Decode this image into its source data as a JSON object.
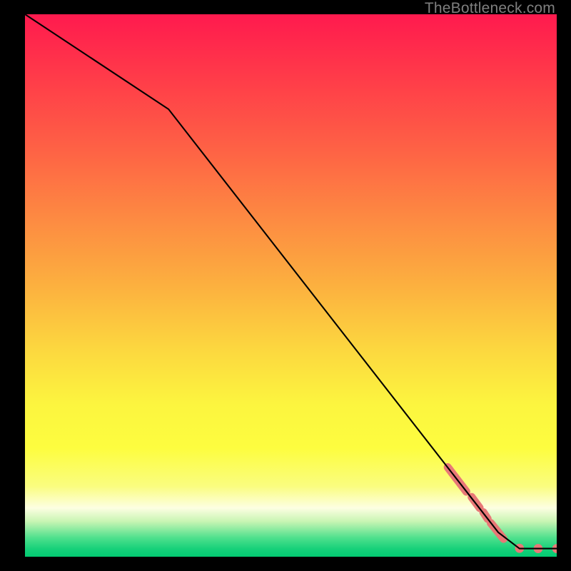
{
  "watermark": "TheBottleneck.com",
  "colors": {
    "background_outer": "#000000",
    "line": "#000000",
    "marker": "#e87877",
    "gradient_stops": [
      {
        "offset": 0.0,
        "color": "#ff1a4e"
      },
      {
        "offset": 0.12,
        "color": "#ff3c49"
      },
      {
        "offset": 0.25,
        "color": "#fe6245"
      },
      {
        "offset": 0.37,
        "color": "#fd8842"
      },
      {
        "offset": 0.5,
        "color": "#fcb03f"
      },
      {
        "offset": 0.62,
        "color": "#fcd83f"
      },
      {
        "offset": 0.72,
        "color": "#fcf53f"
      },
      {
        "offset": 0.8,
        "color": "#fdfd3f"
      },
      {
        "offset": 0.87,
        "color": "#fafd7f"
      },
      {
        "offset": 0.91,
        "color": "#fdfee2"
      },
      {
        "offset": 0.935,
        "color": "#c8f5b3"
      },
      {
        "offset": 0.965,
        "color": "#4fe08d"
      },
      {
        "offset": 0.985,
        "color": "#18d17a"
      },
      {
        "offset": 1.0,
        "color": "#02ca72"
      }
    ]
  },
  "chart_data": {
    "type": "line",
    "title": "",
    "xlabel": "",
    "ylabel": "",
    "xlim": [
      0,
      100
    ],
    "ylim": [
      0,
      100
    ],
    "line_points": [
      {
        "x": 0,
        "y": 100
      },
      {
        "x": 27,
        "y": 82.5
      },
      {
        "x": 89,
        "y": 4.5
      },
      {
        "x": 93,
        "y": 1.5
      },
      {
        "x": 100,
        "y": 1.5
      }
    ],
    "marker_segments": [
      {
        "x1": 79.5,
        "y1": 16.5,
        "x2": 83.0,
        "y2": 12.0
      },
      {
        "x1": 84.0,
        "y1": 11.0,
        "x2": 85.5,
        "y2": 9.0
      },
      {
        "x1": 86.2,
        "y1": 8.2,
        "x2": 87.0,
        "y2": 7.0
      },
      {
        "x1": 87.6,
        "y1": 6.2,
        "x2": 90.0,
        "y2": 3.3
      }
    ],
    "marker_points": [
      {
        "x": 93.0,
        "y": 1.55
      },
      {
        "x": 96.5,
        "y": 1.5
      },
      {
        "x": 100.0,
        "y": 1.5
      }
    ]
  }
}
